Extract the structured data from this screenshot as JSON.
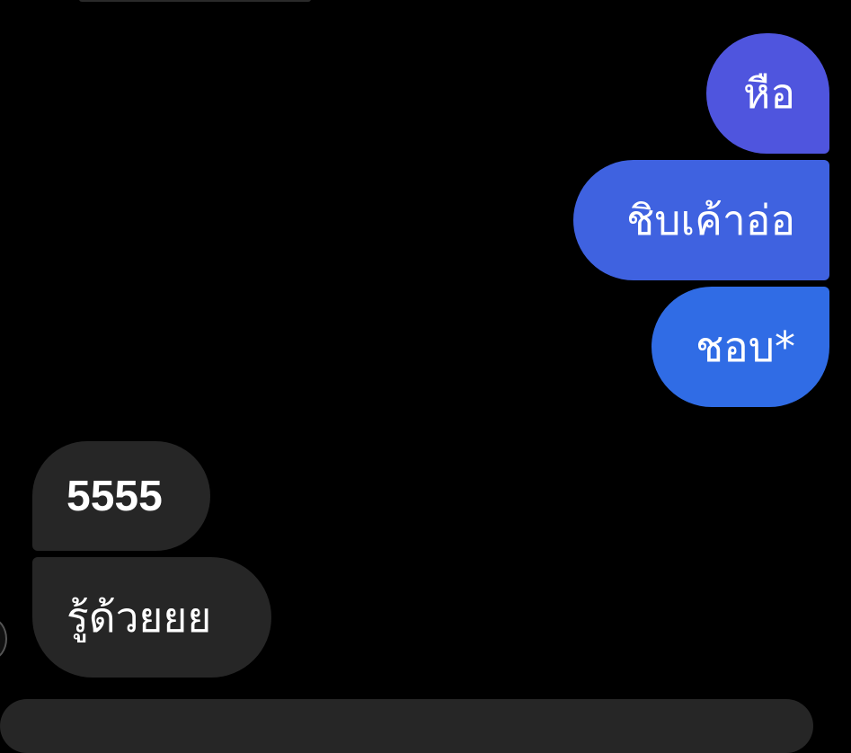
{
  "conversation": {
    "messages": [
      {
        "sender": "me",
        "text": "หือ"
      },
      {
        "sender": "me",
        "text": "ชิบเค้าอ่อ"
      },
      {
        "sender": "me",
        "text": "ชอบ*"
      },
      {
        "sender": "them",
        "text": "5555"
      },
      {
        "sender": "them",
        "text": "รู้ด้วยยย"
      }
    ]
  },
  "colors": {
    "background": "#000000",
    "outgoing_bubble_top": "#4f55de",
    "outgoing_bubble_mid": "#3f62e0",
    "outgoing_bubble_bottom": "#306ce5",
    "incoming_bubble": "#262626",
    "text": "#ffffff"
  }
}
